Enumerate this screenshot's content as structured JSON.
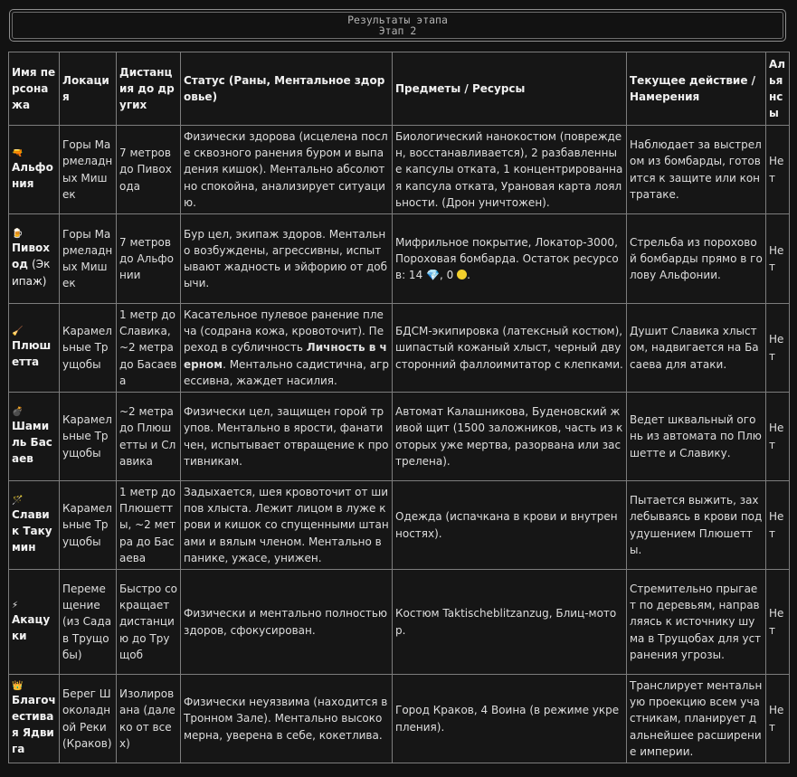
{
  "header": {
    "title": "Результаты этапа",
    "subtitle": "Этап 2"
  },
  "table": {
    "columns": [
      "Имя персонажа",
      "Локация",
      "Дистанция до других",
      "Статус (Раны, Ментальное здоровье)",
      "Предметы / Ресурсы",
      "Текущее действие / Намерения",
      "Альянсы"
    ],
    "rows": [
      {
        "emoji": "🔫",
        "name": "Альфония",
        "name_sub": "",
        "location": "Горы Мармеладных Мишек",
        "distance": "7 метров до Пивохода",
        "status": "Физически здорова (исцелена после сквозного ранения буром и выпадения кишок). Ментально абсолютно спокойна, анализирует ситуацию.",
        "status_bold": "",
        "status_after": "",
        "items": "Биологический нанокостюм (поврежден, восстанавливается), 2 разбавленные капсулы отката, 1 концентрированная капсула отката, Урановая карта лояльности. (Дрон уничтожен).",
        "action": "Наблюдает за выстрелом из бомбарды, готовится к защите или контратаке.",
        "alliance": "Нет"
      },
      {
        "emoji": "🍺",
        "name": "Пивоход",
        "name_sub": "(Экипаж)",
        "location": "Горы Мармеладных Мишек",
        "distance": "7 метров до Альфонии",
        "status": "Бур цел, экипаж здоров. Ментально возбуждены, агрессивны, испытывают жадность и эйфорию от добычи.",
        "status_bold": "",
        "status_after": "",
        "items": "Мифрильное покрытие, Локатор-3000, Пороховая бомбарда. Остаток ресурсов: 14",
        "items_gem": "💎",
        "items_sep": ", 0",
        "items_end": ".",
        "action": "Стрельба из пороховой бомбарды прямо в голову Альфонии.",
        "alliance": "Нет"
      },
      {
        "emoji": "🧹",
        "name": "Плюшетта",
        "name_sub": "",
        "location": "Карамельные Трущобы",
        "distance": "1 метр до Славика, ~2 метра до Басаева",
        "status": "Касательное пулевое ранение плеча (содрана кожа, кровоточит). Переход в субличность ",
        "status_bold": "Личность в черном",
        "status_after": ". Ментально садистична, агрессивна, жаждет насилия.",
        "items": "БДСМ-экипировка (латексный костюм), шипастый кожаный хлыст, черный двусторонний фаллоимитатор с клепками.",
        "action": "Душит Славика хлыстом, надвигается на Басаева для атаки.",
        "alliance": "Нет"
      },
      {
        "emoji": "💣",
        "name": "Шамиль Басаев",
        "name_sub": "",
        "location": "Карамельные Трущобы",
        "distance": "~2 метра до Плюшетты и Славика",
        "status": "Физически цел, защищен горой трупов. Ментально в ярости, фанатичен, испытывает отвращение к противникам.",
        "status_bold": "",
        "status_after": "",
        "items": "Автомат Калашникова, Буденовский живой щит (1500 заложников, часть из которых уже мертва, разорвана или застрелена).",
        "action": "Ведет шквальный огонь из автомата по Плюшетте и Славику.",
        "alliance": "Нет"
      },
      {
        "emoji": "🪄",
        "name": "Славик Такумин",
        "name_sub": "",
        "location": "Карамельные Трущобы",
        "distance": "1 метр до Плюшетты, ~2 метра до Басаева",
        "status": "Задыхается, шея кровоточит от шипов хлыста. Лежит лицом в луже крови и кишок со спущенными штанами и вялым членом. Ментально в панике, ужасе, унижен.",
        "status_bold": "",
        "status_after": "",
        "items": "Одежда (испачкана в крови и внутренностях).",
        "action": "Пытается выжить, захлебываясь в крови под удушением Плюшетты.",
        "alliance": "Нет"
      },
      {
        "emoji": "⚡",
        "name": "Акацуки",
        "name_sub": "",
        "location": "Перемещение (из Сада в Трущобы)",
        "distance": "Быстро сокращает дистанцию до Трущоб",
        "status": "Физически и ментально полностью здоров, сфокусирован.",
        "status_bold": "",
        "status_after": "",
        "items": "Костюм Taktischeblitzanzug, Блиц-мотор.",
        "action": "Стремительно прыгает по деревьям, направляясь к источнику шума в Трущобах для устранения угрозы.",
        "alliance": "Нет"
      },
      {
        "emoji": "👑",
        "name": "Благочестивая Ядвига",
        "name_sub": "",
        "location": "Берег Шоколадной Реки (Краков)",
        "distance": "Изолирована (далеко от всех)",
        "status": "Физически неуязвима (находится в Тронном Зале). Ментально высокомерна, уверена в себе, кокетлива.",
        "status_bold": "",
        "status_after": "",
        "items": "Город Краков, 4 Воина (в режиме укрепления).",
        "action": "Транслирует ментальную проекцию всем участникам, планирует дальнейшее расширение империи.",
        "alliance": "Нет"
      }
    ]
  }
}
